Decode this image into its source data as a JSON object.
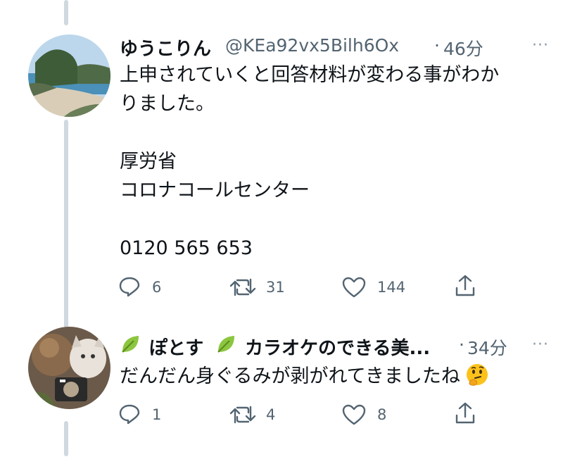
{
  "colors": {
    "thread_line": "#cfd9de",
    "icon": "#536471",
    "text": "#0f1419",
    "secondary": "#536471"
  },
  "tweets": [
    {
      "author_name": "ゆうこりん",
      "handle": "@KEa92vx5Bilh6Ox",
      "separator": "·",
      "time": "46分",
      "more": "···",
      "lines": [
        "上申されていくと回答材料が変わる事がわか",
        "りました。",
        "",
        "厚労省",
        "コロナコールセンター",
        "",
        "0120 565 653"
      ],
      "actions": {
        "reply": "6",
        "retweet": "31",
        "like": "144"
      },
      "icons": [
        "reply-icon",
        "retweet-icon",
        "like-icon",
        "share-icon"
      ]
    },
    {
      "author_name_prefix_icon": "leaf-emoji",
      "author_name_part1": "ぽとす",
      "author_name_part2": "カラオケのできる美...",
      "separator": "·",
      "time": "34分",
      "more": "···",
      "text": "だんだん身ぐるみが剥がれてきましたね",
      "text_emoji": "thinking-face-emoji",
      "actions": {
        "reply": "1",
        "retweet": "4",
        "like": "8"
      },
      "icons": [
        "reply-icon",
        "retweet-icon",
        "like-icon",
        "share-icon"
      ]
    }
  ]
}
